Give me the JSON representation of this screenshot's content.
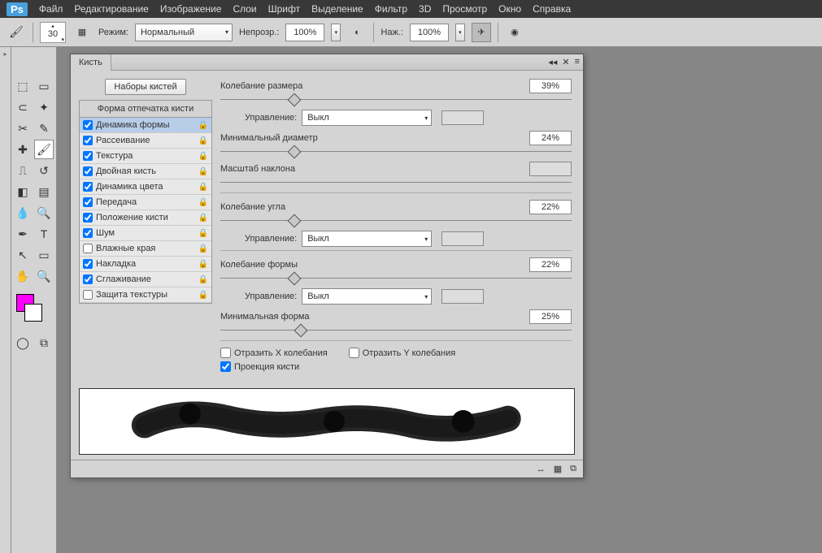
{
  "menu": {
    "items": [
      "Файл",
      "Редактирование",
      "Изображение",
      "Слои",
      "Шрифт",
      "Выделение",
      "Фильтр",
      "3D",
      "Просмотр",
      "Окно",
      "Справка"
    ],
    "logo": "Ps"
  },
  "options": {
    "brush_size": "30",
    "mode_label": "Режим:",
    "mode_value": "Нормальный",
    "opacity_label": "Непрозр.:",
    "opacity_value": "100%",
    "flow_label": "Наж.:",
    "flow_value": "100%"
  },
  "panel": {
    "title": "Кисть",
    "presets_btn": "Наборы кистей",
    "tip_header": "Форма отпечатка кисти",
    "options": [
      {
        "label": "Динамика формы",
        "checked": true,
        "lock": true,
        "selected": true
      },
      {
        "label": "Рассеивание",
        "checked": true,
        "lock": true
      },
      {
        "label": "Текстура",
        "checked": true,
        "lock": true
      },
      {
        "label": "Двойная кисть",
        "checked": true,
        "lock": true
      },
      {
        "label": "Динамика цвета",
        "checked": true,
        "lock": true
      },
      {
        "label": "Передача",
        "checked": true,
        "lock": true
      },
      {
        "label": "Положение кисти",
        "checked": true,
        "lock": true
      },
      {
        "label": "Шум",
        "checked": true,
        "lock": true
      },
      {
        "label": "Влажные края",
        "checked": false,
        "lock": true
      },
      {
        "label": "Накладка",
        "checked": true,
        "lock": true
      },
      {
        "label": "Сглаживание",
        "checked": true,
        "lock": true
      },
      {
        "label": "Защита текстуры",
        "checked": false,
        "lock": true
      }
    ],
    "controls": {
      "size_jitter": {
        "label": "Колебание размера",
        "value": "39%",
        "pos": 21
      },
      "control_label": "Управление:",
      "control_value": "Выкл",
      "min_diam": {
        "label": "Минимальный диаметр",
        "value": "24%",
        "pos": 21
      },
      "tilt_scale": {
        "label": "Масштаб наклона",
        "disabled": true
      },
      "angle_jitter": {
        "label": "Колебание угла",
        "value": "22%",
        "pos": 21
      },
      "round_jitter": {
        "label": "Колебание формы",
        "value": "22%",
        "pos": 21
      },
      "min_round": {
        "label": "Минимальная форма",
        "value": "25%",
        "pos": 23
      },
      "flip_x": "Отразить X колебания",
      "flip_y": "Отразить Y колебания",
      "projection": "Проекция кисти"
    }
  }
}
